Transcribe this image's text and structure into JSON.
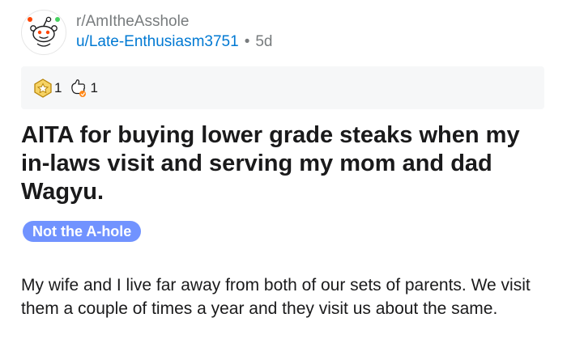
{
  "post": {
    "subreddit": "r/AmItheAsshole",
    "author": "u/Late-Enthusiasm3751",
    "separator": "•",
    "age": "5d",
    "title": "AITA for buying lower grade steaks when my in-laws visit and serving my mom and dad Wagyu.",
    "flair": "Not the A-hole",
    "body": "My wife and I live far away from both of our sets of parents.  We visit them a couple of times a year and they visit us about the same."
  },
  "awards": [
    {
      "icon": "helpful-award-icon",
      "count": "1"
    },
    {
      "icon": "wholesome-award-icon",
      "count": "1"
    }
  ],
  "colors": {
    "author": "#0079d3",
    "meta": "#787c7e",
    "flair_bg": "#7193ff",
    "flair_text": "#ffffff",
    "award_bar_bg": "#f6f7f8",
    "text": "#1a1a1b"
  }
}
